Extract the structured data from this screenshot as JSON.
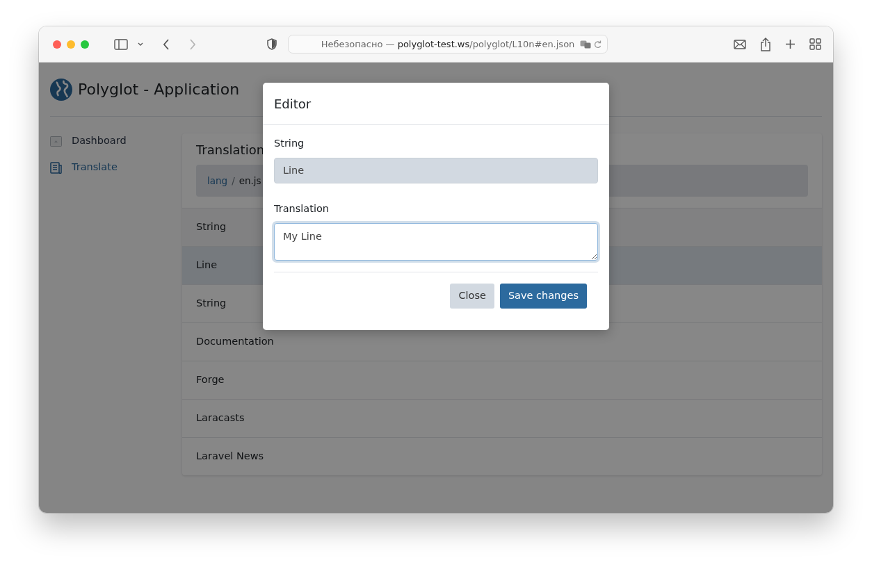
{
  "browser": {
    "back": {
      "disabled": false
    },
    "forward": {
      "disabled": true
    },
    "address": {
      "prefix": "Небезопасно — ",
      "host": "polyglot-test.ws",
      "path": "/polyglot/L10n#en.json"
    }
  },
  "app": {
    "title": "Polyglot - Application"
  },
  "sidebar": {
    "items": [
      {
        "label": "Dashboard",
        "kind": "dashboard",
        "selected": false
      },
      {
        "label": "Translate",
        "kind": "document",
        "selected": true
      }
    ]
  },
  "card": {
    "title": "Translation",
    "breadcrumb": [
      {
        "label": "lang",
        "link": true
      },
      {
        "label": "en.js",
        "link": false
      }
    ],
    "breadcrumb_separator": "/",
    "header": "String",
    "rows": [
      {
        "string": "Line",
        "selected": true
      },
      {
        "string": "String",
        "selected": false
      },
      {
        "string": "Documentation",
        "selected": false
      },
      {
        "string": "Forge",
        "selected": false
      },
      {
        "string": "Laracasts",
        "selected": false
      },
      {
        "string": "Laravel News",
        "selected": false
      }
    ]
  },
  "modal": {
    "title": "Editor",
    "fields": [
      {
        "label": "String",
        "kind": "input",
        "value": "Line",
        "disabled": true,
        "focused": false
      },
      {
        "label": "Translation",
        "kind": "textarea",
        "value": "My Line",
        "disabled": false,
        "focused": true
      }
    ],
    "buttons": [
      {
        "label": "Close",
        "kind": "secondary"
      },
      {
        "label": "Save changes",
        "kind": "primary"
      }
    ]
  }
}
